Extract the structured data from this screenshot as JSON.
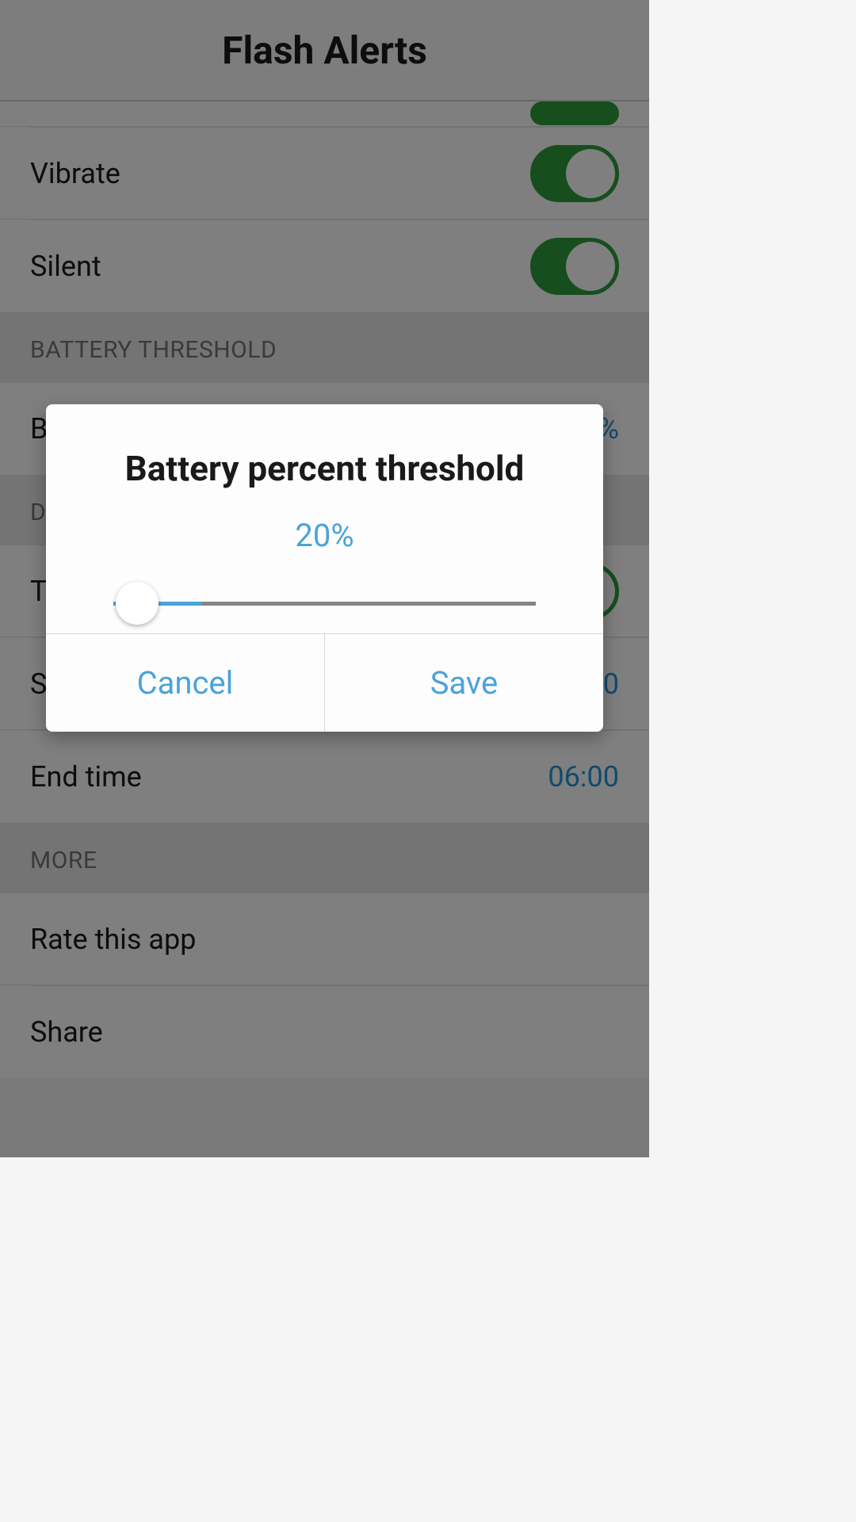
{
  "header": {
    "title": "Flash Alerts"
  },
  "settings": {
    "vibrate_label": "Vibrate",
    "silent_label": "Silent"
  },
  "battery": {
    "section_label": "BATTERY THRESHOLD",
    "item_label": "B"
  },
  "dnd": {
    "section_label": "D",
    "toggle_label": "T",
    "start_label": "S",
    "end_label": "End time",
    "end_value": "06:00"
  },
  "more": {
    "section_label": "MORE",
    "rate_label": "Rate this app",
    "share_label": "Share"
  },
  "dialog": {
    "title": "Battery percent threshold",
    "value": "20%",
    "cancel_label": "Cancel",
    "save_label": "Save"
  }
}
